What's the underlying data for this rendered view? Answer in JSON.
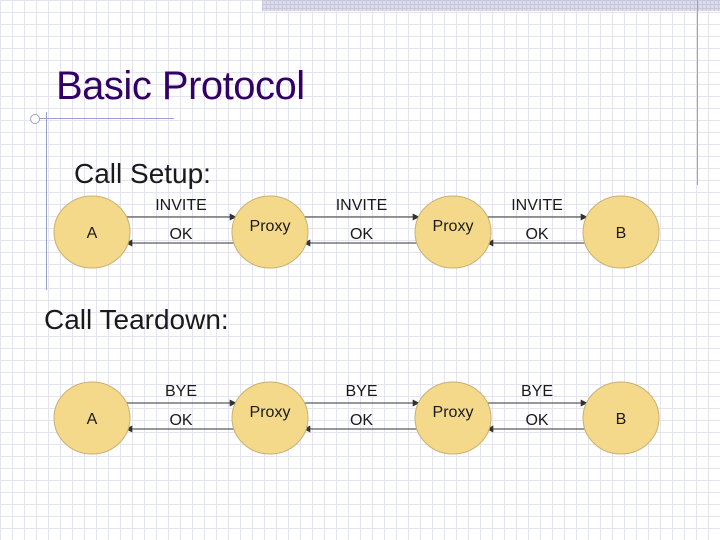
{
  "slide": {
    "title": "Basic Protocol"
  },
  "sections": [
    {
      "heading": "Call Setup:",
      "nodes": [
        "A",
        "Proxy",
        "Proxy",
        "B"
      ],
      "requests": [
        "INVITE",
        "INVITE",
        "INVITE"
      ],
      "responses": [
        "OK",
        "OK",
        "OK"
      ]
    },
    {
      "heading": "Call Teardown:",
      "nodes": [
        "A",
        "Proxy",
        "Proxy",
        "B"
      ],
      "requests": [
        "BYE",
        "BYE",
        "BYE"
      ],
      "responses": [
        "OK",
        "OK",
        "OK"
      ]
    }
  ],
  "colors": {
    "title": "#330066",
    "node_fill": "#f4d98b",
    "node_stroke": "#c9b072",
    "arrow": "#333333"
  }
}
